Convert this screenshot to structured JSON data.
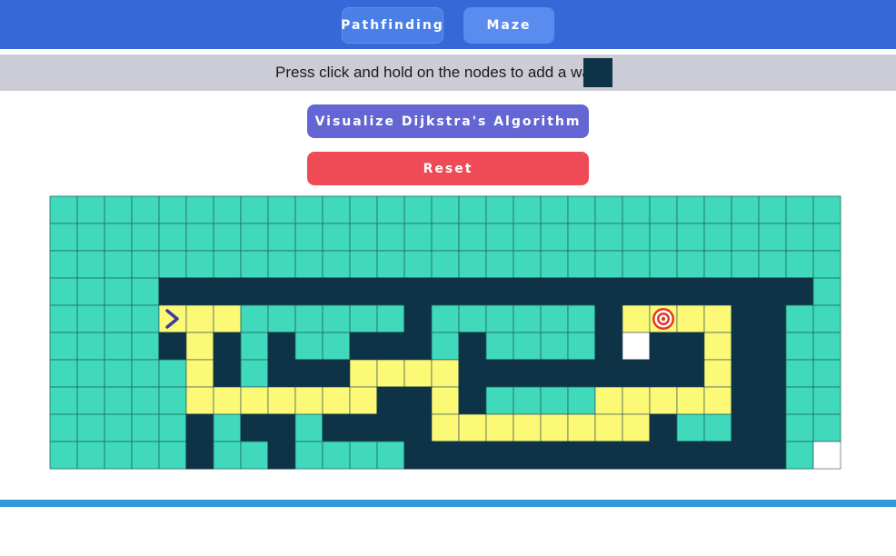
{
  "nav": {
    "pathfinding_label": "Pathfinding",
    "maze_label": "Maze"
  },
  "info": {
    "instruction": "Press click and hold on the nodes to add a wall"
  },
  "actions": {
    "visualize_label": "Visualize Dijkstra's Algorithm",
    "reset_label": "Reset"
  },
  "colors": {
    "header": "#3768d8",
    "wall": "#0e3347",
    "visited": "#40d9bb",
    "path": "#fbf975",
    "unvisited": "#ffffff",
    "start_icon": "#3b3b9e",
    "target_icon": "#e23a25",
    "footer": "#3498db"
  },
  "grid": {
    "rows": 10,
    "cols": 29,
    "legend": {
      "V": "visited-node",
      "W": "wall-node",
      "P": "path-node",
      "S": "start-node",
      "T": "target-node",
      "U": "unvisited-node"
    },
    "cells": [
      "VVVVVVVVVVVVVVVVVVVVVVVVVVVVV",
      "VVVVVVVVVVVVVVVVVVVVVVVVVVVVV",
      "VVVVVVVVVVVVVVVVVVVVVVVVVVVVV",
      "VVVVWWWWWWWWWWWWWWWWWWWWWWWWV",
      "VVVVSPPVVVVVVWVVVVVVWTPPPWWVV",
      "VVVVWPWVWVVWWWVWVVVVWUWWPWWVV",
      "VVVVVPWVWWWPPPPWWWWWWWWWPWWVV",
      "VVVVVPPPPPPPWWPWVVVVPPPPPWWVV",
      "VVVVVWVWWVWWWWPPPPPPPPWVVWWVV",
      "VVVVVWVVWVVVVWWWWWWWWWWWWWWVU"
    ],
    "start": {
      "row": 4,
      "col": 4,
      "icon": "chevron-right-icon"
    },
    "target": {
      "row": 4,
      "col": 22,
      "icon": "target-icon"
    }
  }
}
